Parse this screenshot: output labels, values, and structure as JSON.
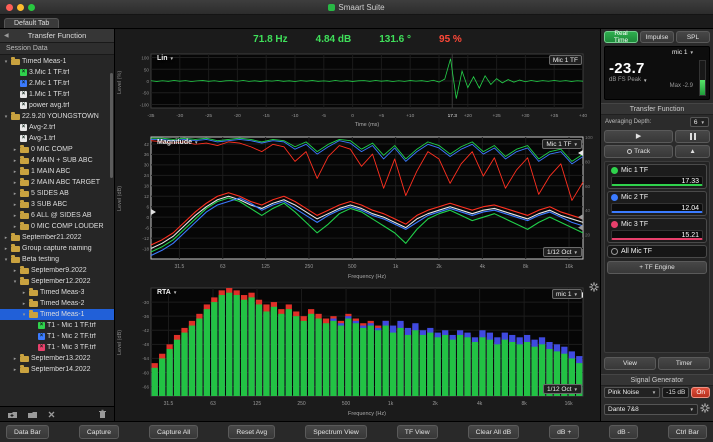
{
  "window": {
    "title": "Smaart Suite",
    "tab": "Default Tab"
  },
  "readouts": {
    "frequency": "71.8 Hz",
    "magnitude": "4.84 dB",
    "phase": "131.6 °",
    "coherence": "95 %"
  },
  "sidebar": {
    "title": "Transfer Function",
    "section": "Session Data",
    "tree": [
      {
        "label": "Timed Meas-1",
        "depth": 0,
        "kind": "folder",
        "arrow": "open"
      },
      {
        "label": "3.Mic 1 TF.trf",
        "depth": 1,
        "kind": "trf",
        "color": "#2fd24c"
      },
      {
        "label": "2.Mic 1 TF.trf",
        "depth": 1,
        "kind": "trf",
        "color": "#3b7bff"
      },
      {
        "label": "1.Mic 1 TF.trf",
        "depth": 1,
        "kind": "trf",
        "color": "#e8e8e8"
      },
      {
        "label": "power avg.trf",
        "depth": 1,
        "kind": "trf",
        "color": "#e8e8e8"
      },
      {
        "label": "22.9.20 YOUNGSTOWN",
        "depth": 0,
        "kind": "folder",
        "arrow": "open"
      },
      {
        "label": "Avg-2.trf",
        "depth": 1,
        "kind": "trf",
        "color": "#e8e8e8"
      },
      {
        "label": "Avg-1.trf",
        "depth": 1,
        "kind": "trf",
        "color": "#e8e8e8"
      },
      {
        "label": "0 MIC COMP",
        "depth": 1,
        "kind": "folder",
        "arrow": "closed"
      },
      {
        "label": "4 MAIN + SUB ABC",
        "depth": 1,
        "kind": "folder",
        "arrow": "closed"
      },
      {
        "label": "1 MAIN ABC",
        "depth": 1,
        "kind": "folder",
        "arrow": "closed"
      },
      {
        "label": "2 MAIN ABC TARGET",
        "depth": 1,
        "kind": "folder",
        "arrow": "closed"
      },
      {
        "label": "5 SIDES AB",
        "depth": 1,
        "kind": "folder",
        "arrow": "closed"
      },
      {
        "label": "3 SUB ABC",
        "depth": 1,
        "kind": "folder",
        "arrow": "closed"
      },
      {
        "label": "6 ALL @ SIDES AB",
        "depth": 1,
        "kind": "folder",
        "arrow": "closed"
      },
      {
        "label": "0 MIC COMP LOUDER",
        "depth": 1,
        "kind": "folder",
        "arrow": "closed"
      },
      {
        "label": "September21.2022",
        "depth": 0,
        "kind": "folder",
        "arrow": "closed"
      },
      {
        "label": "Group capture naming",
        "depth": 0,
        "kind": "folder",
        "arrow": "closed"
      },
      {
        "label": "Beta testing",
        "depth": 0,
        "kind": "folder",
        "arrow": "open"
      },
      {
        "label": "September9.2022",
        "depth": 1,
        "kind": "folder",
        "arrow": "closed"
      },
      {
        "label": "September12.2022",
        "depth": 1,
        "kind": "folder",
        "arrow": "open"
      },
      {
        "label": "Timed Meas-3",
        "depth": 2,
        "kind": "folder",
        "arrow": "closed"
      },
      {
        "label": "Timed Meas-2",
        "depth": 2,
        "kind": "folder",
        "arrow": "closed"
      },
      {
        "label": "Timed Meas-1",
        "depth": 2,
        "kind": "folder",
        "arrow": "open",
        "selected": true
      },
      {
        "label": "T1 - Mic 1 TF.trf",
        "depth": 3,
        "kind": "trf",
        "color": "#2fd24c"
      },
      {
        "label": "T1 - Mic 2 TF.trf",
        "depth": 3,
        "kind": "trf",
        "color": "#3b7bff"
      },
      {
        "label": "T1 - Mic 3 TF.trf",
        "depth": 3,
        "kind": "trf",
        "color": "#e8406c"
      },
      {
        "label": "September13.2022",
        "depth": 1,
        "kind": "folder",
        "arrow": "closed"
      },
      {
        "label": "September14.2022",
        "depth": 1,
        "kind": "folder",
        "arrow": "closed"
      }
    ]
  },
  "plots": {
    "ir": {
      "mode": "Lin",
      "trace": "Mic 1 TF",
      "ylabel": "Level (%)",
      "xlabel": "Time (ms)"
    },
    "mag": {
      "mode": "Magnitude",
      "trace": "Mic 1 TF",
      "octave": "1/12 Oct",
      "ylabel": "Level (dB)",
      "xlabel": "Frequency (Hz)"
    },
    "rta": {
      "mode": "RTA",
      "trace": "mic 1",
      "octave": "1/12 Oct",
      "ylabel": "Level (dB)",
      "xlabel": "Frequency (Hz)"
    }
  },
  "right_panel": {
    "modes": {
      "real_time": "Real Time",
      "impulse": "Impulse",
      "spl": "SPL"
    },
    "meter": {
      "source": "mic 1",
      "value": "-23.7",
      "unit": "dB FS Peak",
      "max": "Max -2.9"
    },
    "tf": {
      "title": "Transfer Function",
      "avg_label": "Averaging Depth:",
      "avg_value": "6",
      "track": "Track",
      "engine_button": "+ TF Engine",
      "measurements": [
        {
          "name": "Mic 1 TF",
          "value": "17.33",
          "color": "#2fd24c"
        },
        {
          "name": "Mic 2 TF",
          "value": "12.04",
          "color": "#3b7bff"
        },
        {
          "name": "Mic 3 TF",
          "value": "15.21",
          "color": "#e8406c"
        },
        {
          "name": "All Mic TF",
          "value": "",
          "color": "#777777"
        }
      ]
    },
    "view_button": "View",
    "timer_button": "Timer",
    "siggen": {
      "title": "Signal Generator",
      "source": "Pink Noise",
      "level": "-15 dB",
      "power": "On",
      "output": "Dante 7&8"
    }
  },
  "bottom_bar": {
    "buttons": [
      "Data Bar",
      "Capture",
      "Capture All",
      "Reset Avg",
      "Spectrum View",
      "TF View",
      "Clear All dB",
      "dB +",
      "dB -",
      "Ctrl Bar"
    ]
  },
  "chart_data": [
    {
      "id": "live_ir",
      "type": "line",
      "title": "Live IR (Lin)",
      "x_start": -35,
      "x_step": 1,
      "x_end": 40,
      "y_range": [
        -115,
        115
      ],
      "yticks": [
        100,
        50,
        0,
        -50,
        -100
      ],
      "xtick_labels": [
        "-35",
        "-30",
        "-25",
        "-20",
        "-15",
        "-10",
        "-5",
        "0",
        "+5",
        "+10",
        "17.3",
        "+20",
        "+25",
        "+30",
        "+35",
        "+40"
      ],
      "peak_ms": 17.3,
      "series": [
        {
          "name": "Mic 1 TF impulse",
          "color": "#25d24a",
          "values": [
            1.2,
            -1.8,
            1.0,
            -1.3,
            2.0,
            -0.8,
            1.5,
            -2.0,
            0.5,
            1.8,
            -1.3,
            1.0,
            -2.2,
            0.8,
            1.5,
            -1.0,
            2.0,
            -1.5,
            0.8,
            -1.8,
            1.3,
            -0.5,
            2.0,
            -1.3,
            0.8,
            -2.0,
            1.5,
            -0.8,
            1.8,
            -1.3,
            0.5,
            -1.5,
            2.2,
            -1.0,
            1.3,
            -1.8,
            0.8,
            1.5,
            -1.3,
            2.0,
            -0.8,
            1.3,
            -2.0,
            1.0,
            -1.5,
            1.8,
            -0.5,
            1.3,
            -2.2,
            3.0,
            -4.5,
            8.0,
            95,
            -75,
            42,
            -28,
            18,
            -30,
            22,
            -15,
            10,
            -8,
            6,
            -5,
            4,
            -3,
            2.2,
            -1.8,
            1.5,
            -1.2,
            2.0,
            -1.0,
            1.5,
            -1.8,
            1.2,
            -0.8
          ]
        }
      ]
    },
    {
      "id": "magnitude",
      "type": "line",
      "title": "Magnitude / Coherence",
      "log_f_range": [
        20,
        20000
      ],
      "y_range": [
        -24,
        46
      ],
      "yticks": [
        42,
        36,
        30,
        24,
        18,
        12,
        6,
        0,
        -6,
        -12,
        -18
      ],
      "coherence_ticks": [
        100,
        80,
        60,
        40,
        20
      ],
      "xticks": [
        {
          "f": 31.5,
          "label": "31.5"
        },
        {
          "f": 63,
          "label": "63"
        },
        {
          "f": 125,
          "label": "125"
        },
        {
          "f": 250,
          "label": "250"
        },
        {
          "f": 500,
          "label": "500"
        },
        {
          "f": 1000,
          "label": "1k"
        },
        {
          "f": 2000,
          "label": "2k"
        },
        {
          "f": 4000,
          "label": "4k"
        },
        {
          "f": 8000,
          "label": "8k"
        },
        {
          "f": 16000,
          "label": "16k"
        }
      ],
      "series": [
        {
          "name": "All Mic TF magnitude",
          "axis": "db",
          "color": "#e6e6e6",
          "values": [
            -18,
            -15,
            -11,
            -5,
            1,
            6,
            10,
            12,
            10,
            7,
            5,
            8,
            10,
            7,
            3,
            -1,
            2,
            5,
            7,
            5,
            2,
            0,
            -3,
            -6,
            -1,
            2,
            4,
            6,
            4,
            2,
            4,
            5,
            3,
            1,
            -1,
            2,
            4,
            1,
            -1,
            -3
          ]
        },
        {
          "name": "Mic 1 TF magnitude",
          "axis": "db",
          "color": "#21d04a",
          "values": [
            -20,
            -17,
            -13,
            -7,
            -1,
            5,
            9,
            11,
            9,
            5,
            1,
            5,
            8,
            3,
            -3,
            -9,
            -4,
            2,
            5,
            3,
            -1,
            -5,
            -9,
            -15,
            -7,
            -1,
            2,
            4,
            1,
            -2,
            0,
            2,
            -1,
            -4,
            -7,
            -3,
            0,
            -3,
            -6,
            -9
          ]
        },
        {
          "name": "Mic 2 TF magnitude",
          "axis": "db",
          "color": "#3b7bff",
          "values": [
            -22,
            -19,
            -15,
            -9,
            -3,
            3,
            7,
            9,
            11,
            8,
            4,
            7,
            9,
            5,
            1,
            -3,
            1,
            4,
            6,
            4,
            1,
            -1,
            -4,
            -7,
            -3,
            1,
            3,
            5,
            3,
            1,
            3,
            4,
            2,
            0,
            -2,
            1,
            3,
            0,
            -3,
            -5
          ]
        },
        {
          "name": "Mic 3 TF magnitude",
          "axis": "db",
          "color": "#ff3020",
          "values": [
            -16,
            -13,
            -9,
            -3,
            3,
            8,
            12,
            14,
            12,
            9,
            7,
            10,
            12,
            9,
            5,
            1,
            4,
            7,
            9,
            7,
            4,
            2,
            -1,
            -4,
            1,
            4,
            6,
            8,
            6,
            4,
            6,
            7,
            5,
            3,
            1,
            4,
            6,
            3,
            1,
            -1
          ]
        },
        {
          "name": "Mic 1 TF coherence",
          "axis": "coherence",
          "color": "#21d04a",
          "values": [
            99,
            99,
            98,
            99,
            98,
            99,
            97,
            98,
            99,
            98,
            96,
            98,
            97,
            92,
            96,
            88,
            94,
            98,
            97,
            90,
            95,
            85,
            93,
            82,
            90,
            96,
            93,
            86,
            92,
            96,
            88,
            93,
            84,
            90,
            93,
            82,
            88,
            90,
            80,
            86
          ]
        },
        {
          "name": "Mic 2 TF coherence",
          "axis": "coherence",
          "color": "#3b7bff",
          "values": [
            98,
            98,
            97,
            98,
            97,
            98,
            96,
            97,
            98,
            97,
            95,
            97,
            96,
            90,
            94,
            86,
            92,
            97,
            95,
            88,
            93,
            82,
            91,
            80,
            88,
            94,
            91,
            84,
            90,
            94,
            86,
            91,
            82,
            88,
            91,
            80,
            86,
            88,
            78,
            84
          ]
        },
        {
          "name": "Mic 3 TF coherence",
          "axis": "coherence",
          "color": "#ff3020",
          "values": [
            97,
            96,
            95,
            96,
            94,
            95,
            93,
            96,
            95,
            92,
            88,
            94,
            92,
            80,
            88,
            66,
            84,
            93,
            90,
            76,
            86,
            58,
            82,
            52,
            72,
            88,
            82,
            62,
            78,
            88,
            68,
            83,
            58,
            73,
            83,
            53,
            68,
            78,
            48,
            63
          ]
        }
      ]
    },
    {
      "id": "rta",
      "type": "bar",
      "title": "RTA 1/12 Oct",
      "log_f_range": [
        24,
        20000
      ],
      "y_range": [
        -70,
        -24
      ],
      "yticks": [
        -30,
        -36,
        -42,
        -48,
        -54,
        -60,
        -66
      ],
      "xticks": [
        {
          "f": 31.5,
          "label": "31.5"
        },
        {
          "f": 63,
          "label": "63"
        },
        {
          "f": 125,
          "label": "125"
        },
        {
          "f": 250,
          "label": "250"
        },
        {
          "f": 500,
          "label": "500"
        },
        {
          "f": 1000,
          "label": "1k"
        },
        {
          "f": 2000,
          "label": "2k"
        },
        {
          "f": 4000,
          "label": "4k"
        },
        {
          "f": 8000,
          "label": "8k"
        },
        {
          "f": 16000,
          "label": "16k"
        }
      ],
      "series": [
        {
          "name": "Mic 3",
          "color": "#e03028",
          "values": [
            -56,
            -52,
            -48,
            -44,
            -41,
            -38,
            -35,
            -31,
            -28,
            -25,
            -24,
            -25,
            -27,
            -26,
            -29,
            -31,
            -30,
            -33,
            -31,
            -34,
            -36,
            -33,
            -35,
            -37,
            -36,
            -38,
            -35,
            -37,
            -39,
            -38,
            -40,
            -38,
            -41,
            -39,
            -42,
            -40,
            -43,
            -42,
            -44,
            -43,
            -45,
            -43,
            -44,
            -46,
            -44,
            -45,
            -47,
            -45,
            -46,
            -47,
            -46,
            -48,
            -47,
            -49,
            -50,
            -51,
            -53,
            -55
          ]
        },
        {
          "name": "Mic 2",
          "color": "#3f4ae0",
          "values": [
            -60,
            -56,
            -52,
            -48,
            -45,
            -42,
            -39,
            -35,
            -32,
            -29,
            -28,
            -29,
            -31,
            -30,
            -33,
            -35,
            -34,
            -36,
            -34,
            -37,
            -39,
            -36,
            -38,
            -40,
            -37,
            -39,
            -36,
            -38,
            -40,
            -39,
            -41,
            -38,
            -40,
            -38,
            -41,
            -39,
            -42,
            -41,
            -43,
            -42,
            -44,
            -42,
            -43,
            -45,
            -42,
            -43,
            -45,
            -43,
            -44,
            -45,
            -44,
            -46,
            -45,
            -47,
            -48,
            -49,
            -51,
            -53
          ]
        },
        {
          "name": "Mic 1",
          "color": "#22c244",
          "values": [
            -58,
            -54,
            -50,
            -46,
            -43,
            -40,
            -37,
            -33,
            -30,
            -27,
            -26,
            -27,
            -29,
            -28,
            -31,
            -34,
            -32,
            -35,
            -33,
            -36,
            -38,
            -35,
            -37,
            -39,
            -38,
            -40,
            -37,
            -39,
            -41,
            -40,
            -42,
            -40,
            -43,
            -41,
            -44,
            -42,
            -44,
            -43,
            -45,
            -44,
            -46,
            -44,
            -45,
            -47,
            -45,
            -46,
            -48,
            -46,
            -47,
            -48,
            -47,
            -49,
            -48,
            -50,
            -51,
            -52,
            -54,
            -56
          ]
        }
      ]
    }
  ]
}
